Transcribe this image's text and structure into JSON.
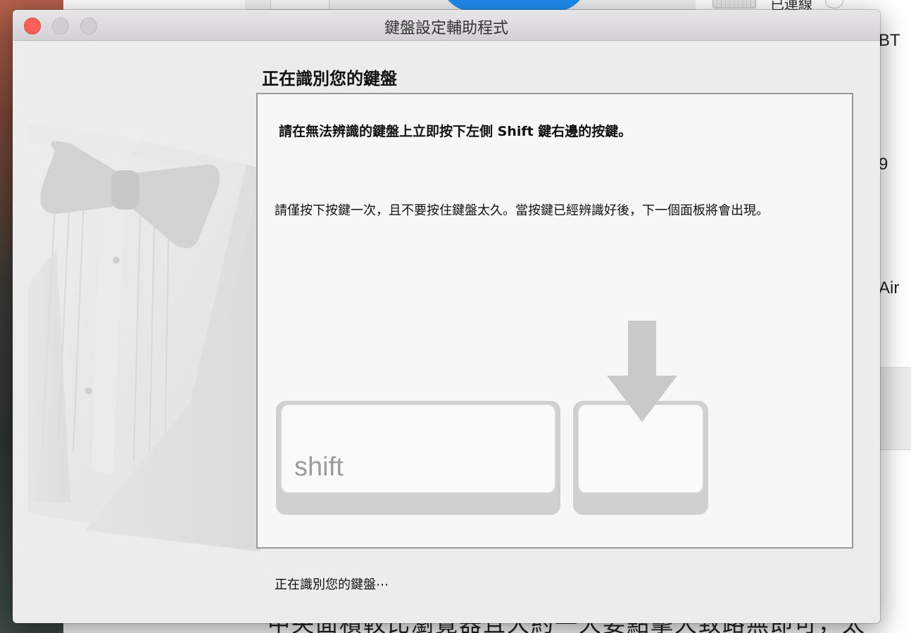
{
  "background": {
    "connected_label": "已連線",
    "side_texts": [
      "BT",
      "9",
      "Air"
    ],
    "side_mark": "-",
    "bottom_text": "中央面積較比瀏覽器且大約一大要點擊大致路無即可，太"
  },
  "window": {
    "title": "鍵盤設定輔助程式"
  },
  "main": {
    "heading": "正在識別您的鍵盤",
    "instruction": "請在無法辨識的鍵盤上立即按下左側 Shift 鍵右邊的按鍵。",
    "note": "請僅按下按鍵一次，且不要按住鍵盤太久。當按鍵已經辨識好後，下一個面板將會出現。",
    "shift_key_label": "shift",
    "status": "正在識別您的鍵盤⋯"
  },
  "icons": [
    "close-icon",
    "minimize-icon",
    "zoom-icon",
    "tuxedo-illustration",
    "arrow-down-icon"
  ],
  "colors": {
    "close_button": "#fc5f57",
    "dialog_background": "#ececec",
    "content_background": "#f7f7f7",
    "arrow": "#c9c9c9"
  }
}
